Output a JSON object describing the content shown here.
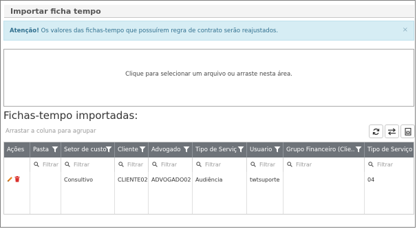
{
  "window": {
    "title": "Importar ficha tempo"
  },
  "alert": {
    "strong": "Atenção!",
    "message": " Os valores das fichas-tempo que possuírem regra de contrato serão reajustados.",
    "close": "×"
  },
  "dropzone": {
    "text": "Clique para selecionar um arquivo ou arraste nesta área."
  },
  "section": {
    "title": "Fichas-tempo importadas:",
    "group_hint": "Arrastar a coluna para agrupar"
  },
  "toolbar": {
    "icons": [
      "refresh-icon",
      "swap-icon",
      "excel-export-icon"
    ]
  },
  "grid": {
    "columns": [
      "Ações",
      "Pasta",
      "Setor de custo",
      "Cliente",
      "Advogado",
      "Tipo de Serviço",
      "Usuario",
      "Grupo Financeiro (Clie...",
      "Tipo de Serviço C"
    ],
    "filter_placeholder": "Filtrar",
    "row": {
      "actions": [
        "edit-icon",
        "delete-icon"
      ],
      "pasta": "",
      "setor": "Consultivo",
      "cliente": "CLIENTE02",
      "advogado": "ADVOGADO02",
      "tipo_servico": "Audiência",
      "usuario": "twtsuporte",
      "grupo_financeiro": "",
      "tipo_servico_c": "04"
    }
  },
  "colors": {
    "header_bg": "#6e7379",
    "alert_bg": "#d6edf4",
    "alert_text": "#31708f",
    "edit": "#e8821e",
    "delete": "#d9302c"
  }
}
